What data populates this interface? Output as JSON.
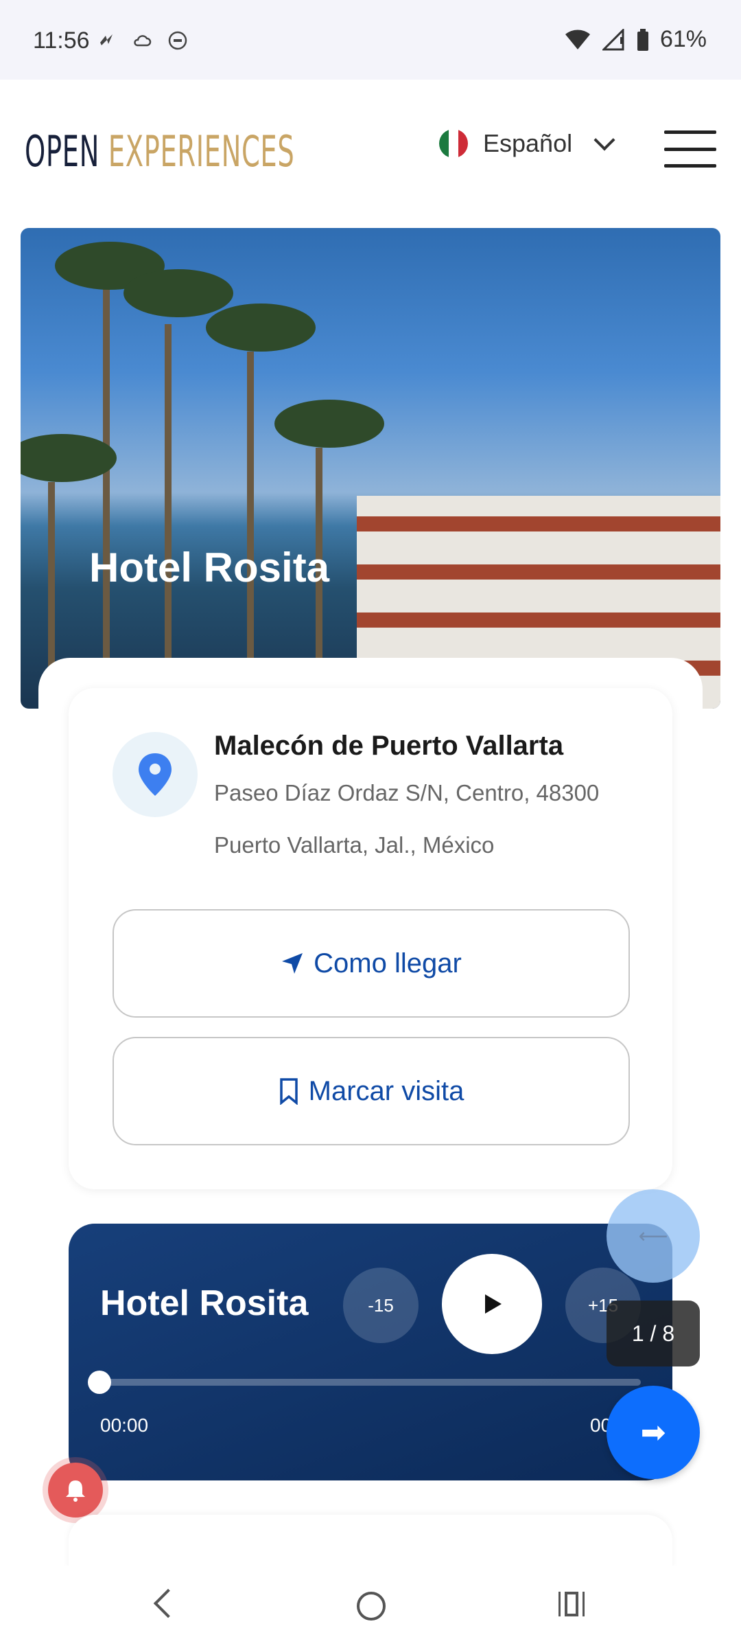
{
  "status_bar": {
    "time": "11:56",
    "battery": "61%"
  },
  "header": {
    "logo_part1": "OPEN",
    "logo_part2": "EXPERIENCES",
    "language": "Español"
  },
  "hero": {
    "title": "Hotel Rosita"
  },
  "location": {
    "name": "Malecón de Puerto Vallarta",
    "address_line1": "Paseo Díaz Ordaz S/N, Centro, 48300",
    "address_line2": "Puerto Vallarta, Jal., México"
  },
  "actions": {
    "directions_label": "Como llegar",
    "mark_visit_label": "Marcar visita"
  },
  "player": {
    "title": "Hotel Rosita",
    "skip_back": "-15",
    "skip_forward": "+15",
    "elapsed": "00:00",
    "duration": "00",
    "progress": 0
  },
  "pager": {
    "counter": "1 / 8"
  },
  "colors": {
    "accent_blue": "#0d6efd",
    "link_blue": "#0f4aa6",
    "logo_navy": "#17203a",
    "logo_gold": "#c9a565",
    "player_bg": "#0c2a58"
  }
}
